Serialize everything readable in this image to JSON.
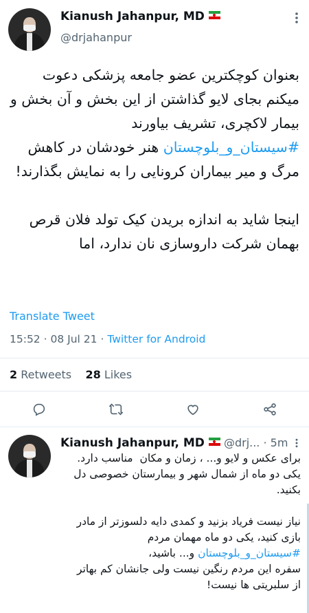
{
  "tweet": {
    "author_name": "Kianush Jahanpur, MD",
    "flag_emoji": "🇮🇷",
    "handle": "@drjahanpur",
    "body_before_hashtag": "بعنوان کوچکترین عضو جامعه پزشکی دعوت میکنم بجای لایو گذاشتن از این بخش و آن بخش و بیمار لاکچری، تشریف بیاورند ",
    "hashtag": "#سیستان_و_بلوچستان",
    "body_after_hashtag": " هنر خودشان در کاهش مرگ و میر بیماران کرونایی را به نمایش بگذارند!\n\nاینجا شاید به اندازه بریدن کیک تولد فلان قرص بهمان شرکت داروسازی نان ندارد، اما",
    "translate_label": "Translate Tweet",
    "time": "15:52",
    "separator": "·",
    "date": "08 Jul 21",
    "source": "Twitter for Android",
    "retweets_count": "2",
    "retweets_label": "Retweets",
    "likes_count": "28",
    "likes_label": "Likes",
    "actions": [
      "reply-icon",
      "retweet-icon",
      "like-icon",
      "share-icon"
    ],
    "colors": {
      "accent": "#1d9bf0",
      "secondary_text": "#536471"
    }
  },
  "reply": {
    "author_name": "Kianush Jahanpur, MD",
    "flag_emoji": "🇮🇷",
    "handle": "@drj...",
    "separator": "·",
    "time": "5m",
    "body_before_hashtag": "برای عکس و لایو و... ، زمان و مکان  مناسب دارد.\nیکی دو ماه از شمال شهر و بیمارستان خصوصی دل بکنید.\n\nنیاز نیست فریاد بزنید و کمدی دایه دلسوزتر از مادر بازی کنید، یکی دو ماه مهمان مردم\n",
    "hashtag": "#سیستان_و_بلوچستان",
    "body_after_hashtag": " و... باشید،\nسفره این مردم رنگین نیست ولی جانشان کم بهاتر از سلبریتی ها نیست!"
  }
}
